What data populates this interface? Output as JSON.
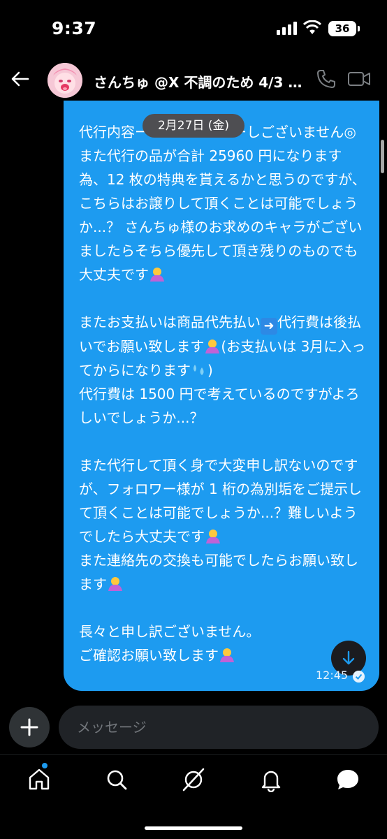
{
  "status_bar": {
    "time": "9:37",
    "battery": "36"
  },
  "header": {
    "title": "さんちゅ @X 不調のため 4/3 …"
  },
  "message": {
    "date_chip": "2月27日 (金)",
    "paragraphs": [
      "代行内容ーーーーーーーーしございません◎ また代行の品が合計 25960 円になります為、12 枚の特典を貰えるかと思うのですが、こちらはお譲りして頂くことは可能でしょうか...？ さんちゅ様のお求めのキャラがございましたらそちら優先して頂き残りのものでも大丈夫です",
      "またお支払いは商品代先払い",
      "代行費は後払いでお願い致します",
      "(お支払いは 3月に入ってからになります",
      "代行費は 1500 円で考えているのですがよろしいでしょうか...？",
      "また代行して頂く身で大変申し訳ないのですが、フォロワー様が 1 桁の為別垢をご提示して頂くことは可能でしょうか...？難しいようでしたら大丈夫です",
      "また連絡先の交換も可能でしたらお願い致します",
      "長々と申し訳ございません。",
      "ご確認お願い致します"
    ],
    "time": "12:45"
  },
  "composer": {
    "placeholder": "メッセージ"
  },
  "colors": {
    "bubble": "#1d9bf0",
    "background": "#000000",
    "chip": "#4e4e52"
  },
  "icons": {
    "nav": [
      "home-icon",
      "search-icon",
      "grok-icon",
      "notifications-icon",
      "messages-icon"
    ]
  }
}
